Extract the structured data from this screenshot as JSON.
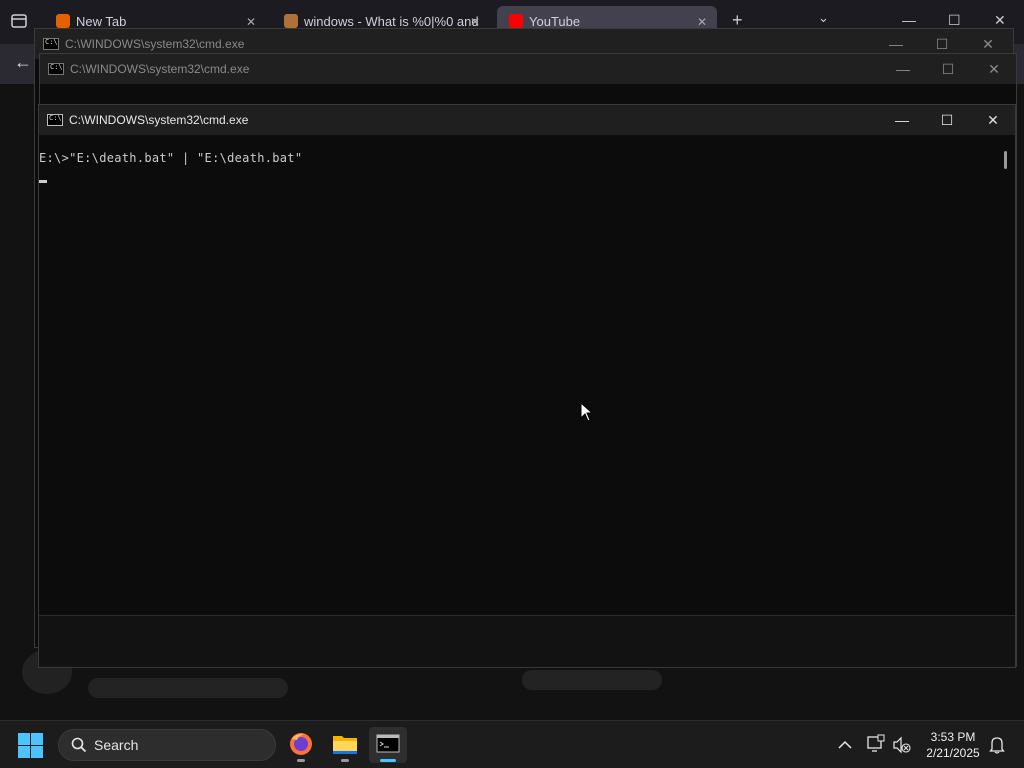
{
  "browser": {
    "tabs": [
      {
        "label": "New Tab",
        "close": "✕"
      },
      {
        "label": "windows - What is %0|%0 and",
        "close": "✕"
      },
      {
        "label": "YouTube",
        "close": "✕"
      }
    ],
    "new_tab": "+",
    "tab_list": "⌄",
    "back": "←"
  },
  "windows": [
    {
      "title": "C:\\WINDOWS\\system32\\cmd.exe"
    },
    {
      "title": "C:\\WINDOWS\\system32\\cmd.exe"
    },
    {
      "title": "C:\\WINDOWS\\system32\\cmd.exe",
      "console_line": "E:\\>\"E:\\death.bat\" | \"E:\\death.bat\""
    }
  ],
  "window_controls": {
    "minimize": "—",
    "maximize": "☐",
    "close": "✕"
  },
  "taskbar": {
    "search_label": "Search",
    "apps": [
      "firefox-icon",
      "file-explorer-icon",
      "terminal-icon"
    ],
    "clock": {
      "time": "3:53 PM",
      "date": "2/21/2025"
    }
  },
  "colors": {
    "accent": "#4cc2ff",
    "console_bg": "#0c0c0c",
    "console_text": "#cccccc"
  }
}
